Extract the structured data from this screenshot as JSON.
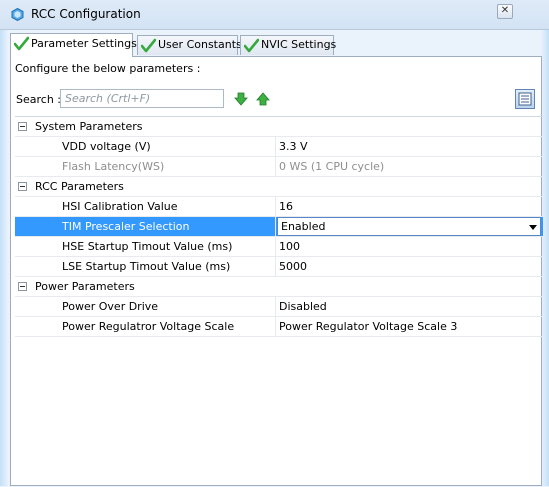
{
  "window": {
    "title": "RCC Configuration",
    "close_symbol": "✕"
  },
  "tabs": [
    {
      "label": "Parameter Settings",
      "active": true
    },
    {
      "label": "User Constants",
      "active": false
    },
    {
      "label": "NVIC Settings",
      "active": false
    }
  ],
  "panel": {
    "configure_label": "Configure the below parameters :",
    "search_label": "Search :",
    "search_placeholder": "Search (Crtl+F)"
  },
  "groups": [
    {
      "label": "System Parameters",
      "rows": [
        {
          "name": "VDD voltage (V)",
          "value": "3.3 V"
        },
        {
          "name": "Flash Latency(WS)",
          "value": "0 WS (1 CPU cycle)"
        }
      ]
    },
    {
      "label": "RCC Parameters",
      "rows": [
        {
          "name": "HSI Calibration Value",
          "value": "16"
        },
        {
          "name": "TIM Prescaler Selection",
          "value": "Enabled"
        },
        {
          "name": "HSE Startup Timout Value (ms)",
          "value": "100"
        },
        {
          "name": "LSE Startup Timout Value (ms)",
          "value": "5000"
        }
      ]
    },
    {
      "label": "Power Parameters",
      "rows": [
        {
          "name": "Power Over Drive",
          "value": "Disabled"
        },
        {
          "name": "Power Regulatror Voltage Scale",
          "value": "Power Regulator Voltage Scale 3"
        }
      ]
    }
  ],
  "colors": {
    "selection": "#3399ff",
    "check_green": "#35a93b"
  }
}
